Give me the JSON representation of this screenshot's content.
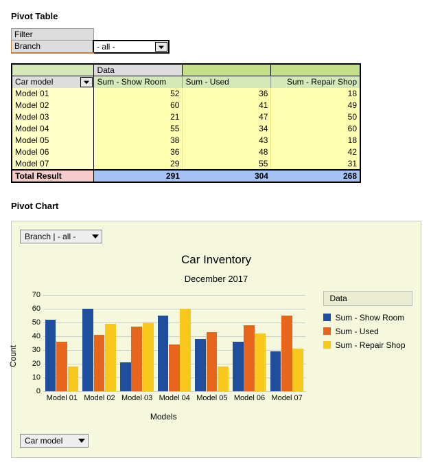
{
  "section_titles": {
    "pivot_table": "Pivot Table",
    "pivot_chart": "Pivot Chart"
  },
  "filter": {
    "header": "Filter",
    "field": "Branch",
    "value": "- all -"
  },
  "pivot": {
    "data_label": "Data",
    "dim_label": "Car model",
    "columns": [
      "Sum - Show Room",
      "Sum - Used",
      "Sum - Repair Shop"
    ],
    "rows": [
      {
        "label": "Model 01",
        "v": [
          52,
          36,
          18
        ]
      },
      {
        "label": "Model 02",
        "v": [
          60,
          41,
          49
        ]
      },
      {
        "label": "Model 03",
        "v": [
          21,
          47,
          50
        ]
      },
      {
        "label": "Model 04",
        "v": [
          55,
          34,
          60
        ]
      },
      {
        "label": "Model 05",
        "v": [
          38,
          43,
          18
        ]
      },
      {
        "label": "Model 06",
        "v": [
          36,
          48,
          42
        ]
      },
      {
        "label": "Model 07",
        "v": [
          29,
          55,
          31
        ]
      }
    ],
    "total_label": "Total Result",
    "totals": [
      291,
      304,
      268
    ]
  },
  "chart_controls": {
    "top_combo": "Branch | - all -",
    "bottom_combo": "Car model"
  },
  "chart": {
    "title": "Car Inventory",
    "subtitle": "December 2017",
    "ylabel": "Count",
    "xlabel": "Models",
    "legend_title": "Data"
  },
  "colors": {
    "series": [
      "#1f4e9c",
      "#e8661c",
      "#f8c91c"
    ]
  },
  "chart_data": {
    "type": "bar",
    "categories": [
      "Model 01",
      "Model 02",
      "Model 03",
      "Model 04",
      "Model 05",
      "Model 06",
      "Model 07"
    ],
    "series": [
      {
        "name": "Sum - Show Room",
        "values": [
          52,
          60,
          21,
          55,
          38,
          36,
          29
        ]
      },
      {
        "name": "Sum - Used",
        "values": [
          36,
          41,
          47,
          34,
          43,
          48,
          55
        ]
      },
      {
        "name": "Sum - Repair Shop",
        "values": [
          18,
          49,
          50,
          60,
          18,
          42,
          31
        ]
      }
    ],
    "title": "Car Inventory",
    "subtitle": "December 2017",
    "xlabel": "Models",
    "ylabel": "Count",
    "ylim": [
      0,
      70
    ],
    "yticks": [
      0,
      10,
      20,
      30,
      40,
      50,
      60,
      70
    ],
    "legend_title": "Data",
    "legend_pos": "right",
    "grid": true
  }
}
